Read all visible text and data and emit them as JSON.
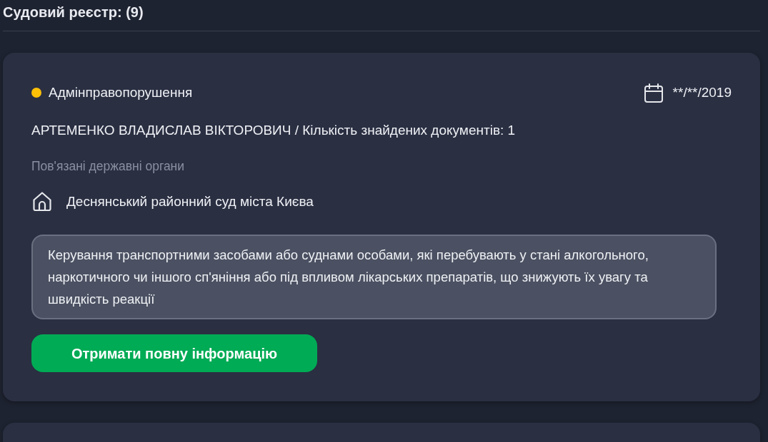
{
  "header": {
    "title": "Судовий реєстр: (9)"
  },
  "cards": [
    {
      "kind": "full",
      "category": {
        "label": "Адмінправопорушення",
        "color": "#ffc107"
      },
      "date": "**/**/2019",
      "title": "АРТЕМЕНКО ВЛАДИСЛАВ ВІКТОРОВИЧ / Кількість знайдених документів: 1",
      "related_label": "Пов'язані державні органи",
      "authorities": [
        "Деснянський районний суд міста Києва"
      ],
      "description": "Керування транспортними засобами або суднами особами, які перебувають у стані алкогольного, наркотичного чи іншого сп'яніння або під впливом лікарських препаратів, що знижують їх увагу та швидкість реакції",
      "button": "Отримати повну інформацію"
    },
    {
      "kind": "cut_off"
    }
  ]
}
